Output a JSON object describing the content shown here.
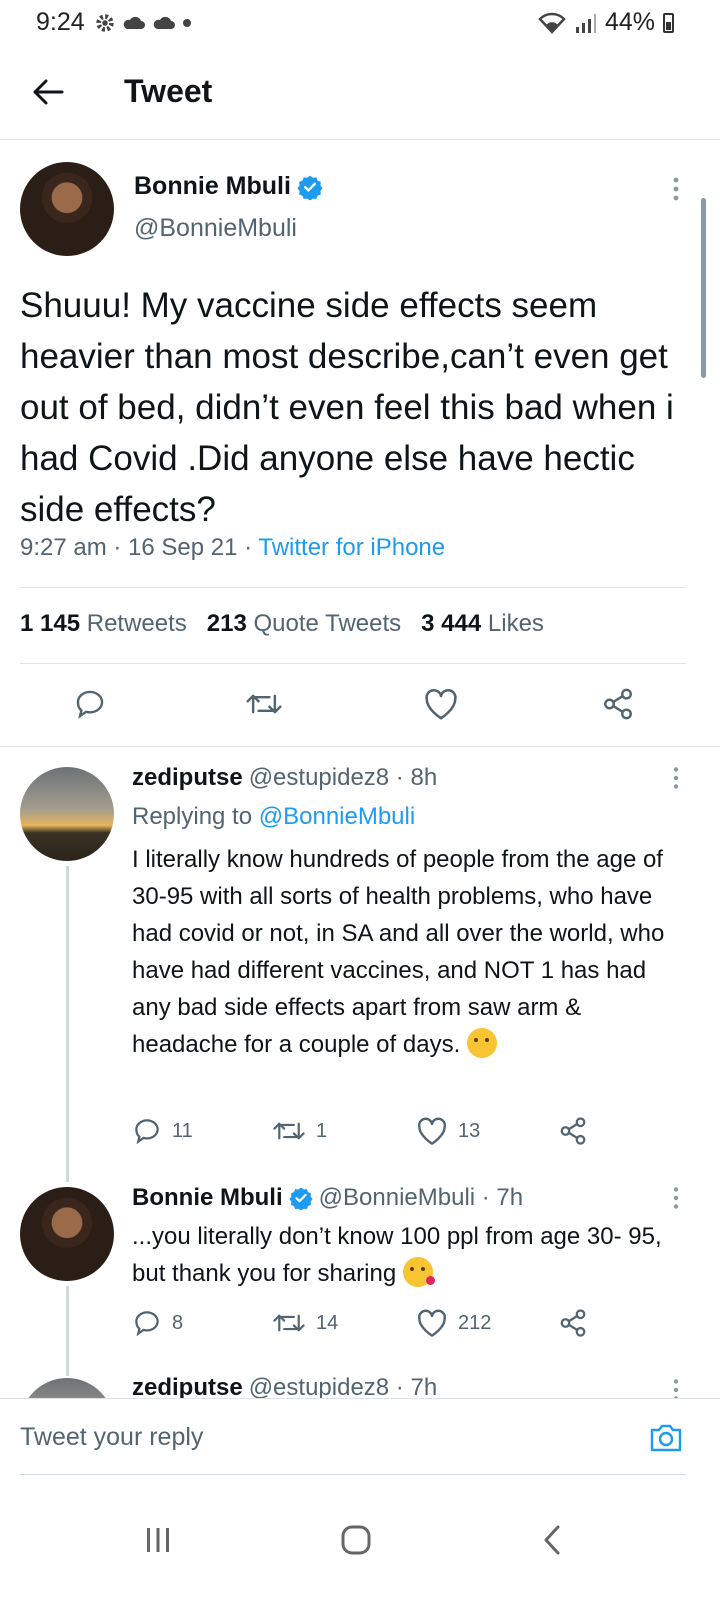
{
  "status_bar": {
    "time": "9:24",
    "battery": "44%"
  },
  "header": {
    "title": "Tweet"
  },
  "main_tweet": {
    "name": "Bonnie Mbuli",
    "handle": "@BonnieMbuli",
    "text": "Shuuu! My vaccine side effects seem heavier than most describe,can’t even get out of bed, didn’t even feel this bad when i had Covid .Did anyone else have hectic side effects?",
    "time": "9:27 am · 16 Sep 21 · ",
    "source": "Twitter for iPhone",
    "retweets_count": "1 145",
    "retweets_label": "Retweets",
    "quotes_count": "213",
    "quotes_label": "Quote Tweets",
    "likes_count": "3 444",
    "likes_label": "Likes"
  },
  "replies": [
    {
      "name": "zediputse",
      "handle": "@estupidez8 · 8h",
      "replying_prefix": "Replying to ",
      "replying_to": "@BonnieMbuli",
      "text": "I literally know hundreds of people from the age of 30-95 with all sorts of health problems, who have had covid or not, in SA and all over the world, who have had different vaccines, and NOT 1 has had any bad side effects apart from saw arm & headache for a couple of days.",
      "emoji": "thinking-face",
      "reply_count": "11",
      "retweet_count": "1",
      "like_count": "13"
    },
    {
      "name": "Bonnie Mbuli",
      "handle": "@BonnieMbuli · 7h",
      "text": "...you literally don’t know 100 ppl from age 30- 95, but thank you for sharing",
      "emoji": "face-blowing-kiss",
      "reply_count": "8",
      "retweet_count": "14",
      "like_count": "212"
    },
    {
      "name": "zediputse",
      "handle": "@estupidez8 · 7h"
    }
  ],
  "reply_bar": {
    "placeholder": "Tweet your reply"
  },
  "colors": {
    "accent": "#1d9bf0",
    "text": "#0f1419",
    "muted": "#536471"
  }
}
